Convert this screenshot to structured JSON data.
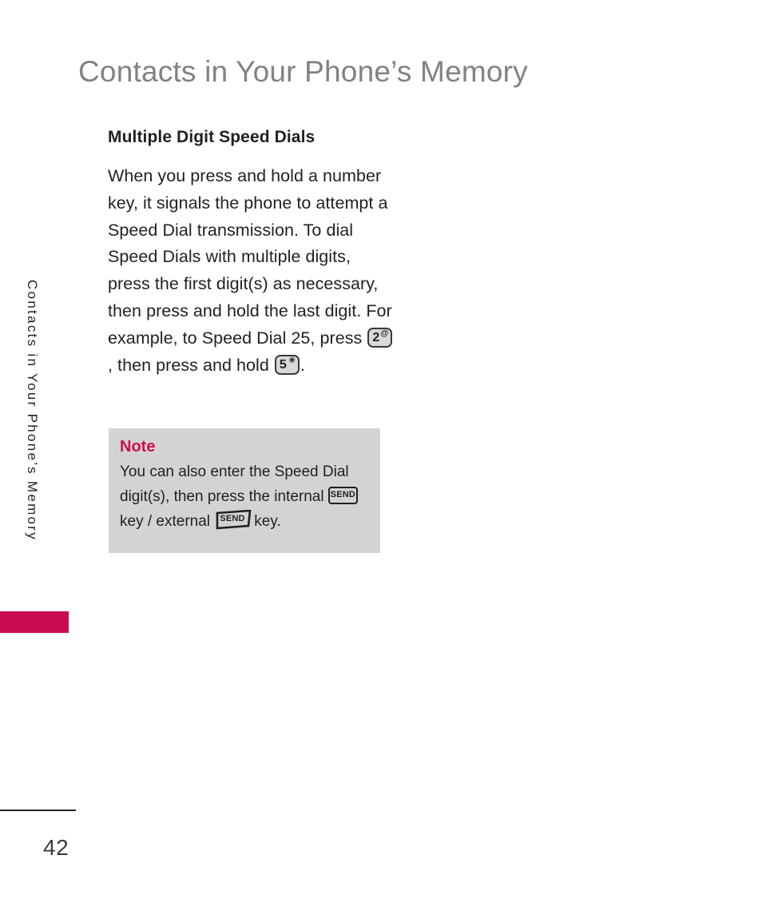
{
  "page": {
    "title": "Contacts in Your Phone’s Memory",
    "running_head": "Contacts in Your Phone’s Memory",
    "number": "42",
    "tab_color": "#c90a50",
    "title_color": "#808284"
  },
  "section": {
    "subhead": "Multiple Digit Speed Dials",
    "paragraph_part1": "When you press and hold a number key, it signals the phone to attempt a Speed Dial transmission. To dial Speed Dials with multiple digits, press the first digit(s) as necessary, then press and hold the last digit. For example, to Speed Dial 25, press",
    "paragraph_part2": ", then press and hold",
    "paragraph_part3": "."
  },
  "keys": {
    "key2": {
      "label": "2",
      "superscript": "@",
      "name": "key-2"
    },
    "key5": {
      "label": "5",
      "superscript": "✳",
      "name": "key-5"
    },
    "send_internal": {
      "label": "SEND"
    },
    "send_external": {
      "label": "SEND"
    }
  },
  "note": {
    "heading": "Note",
    "heading_color": "#ce0e52",
    "background_color": "#d2d3d5",
    "text_part1": "You can also enter the Speed Dial digit(s), then press the internal",
    "text_part2": "key / external",
    "text_part3": "key."
  }
}
